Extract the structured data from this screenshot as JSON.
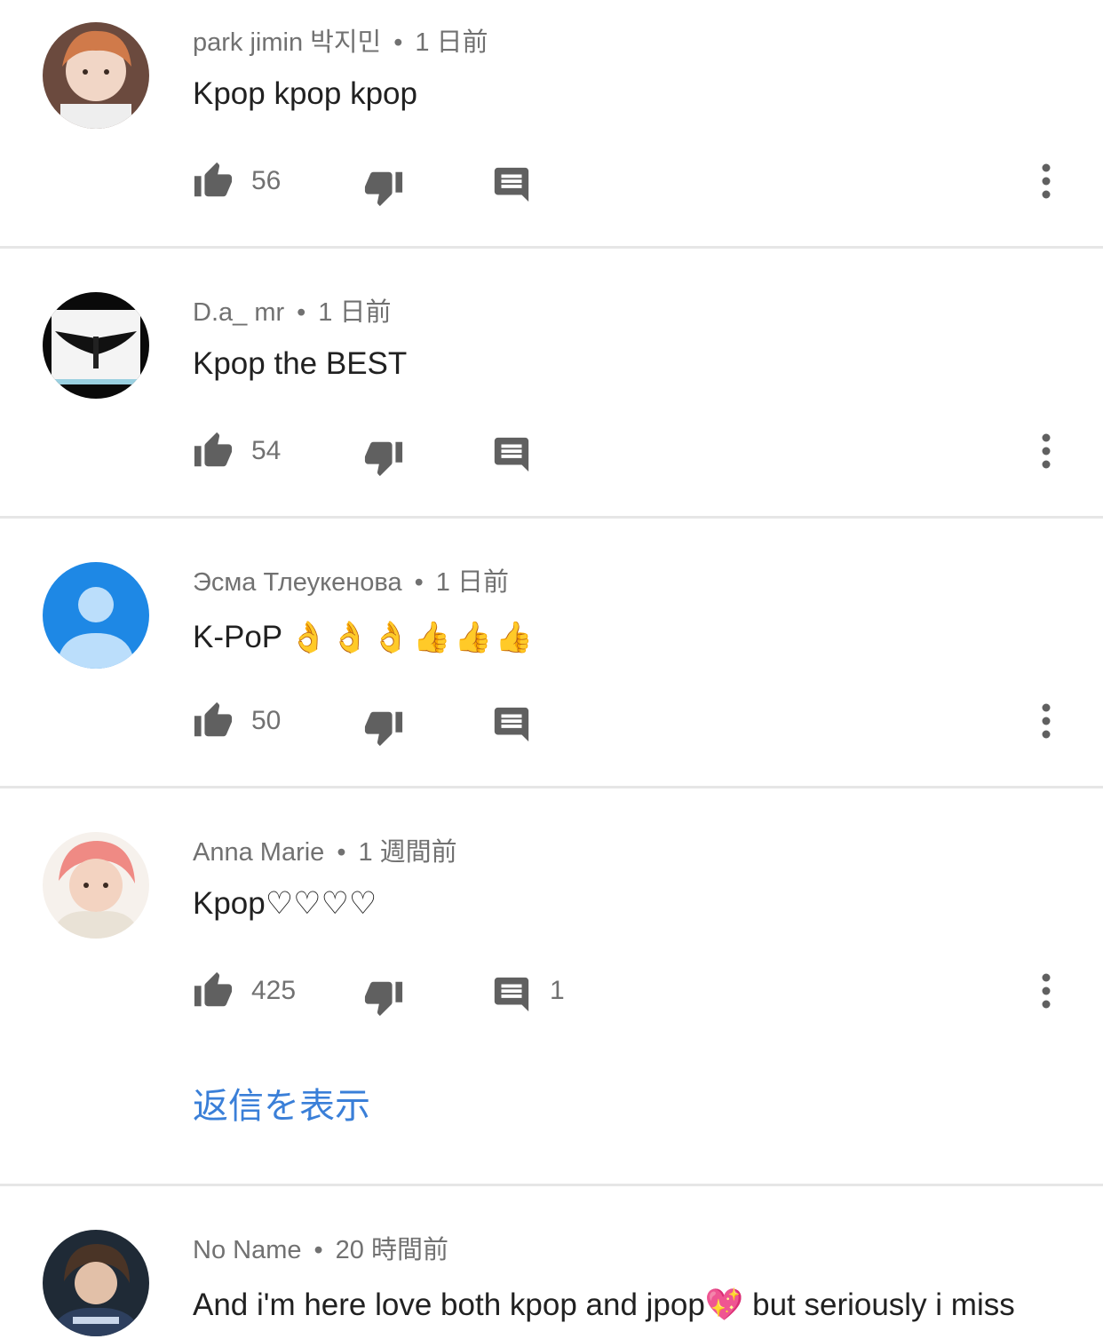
{
  "comments": [
    {
      "author": "park jimin 박지민",
      "time": "1 日前",
      "text": "Kpop kpop kpop",
      "emoji": "",
      "likes": "56",
      "replies": ""
    },
    {
      "author": "D.a_ mr",
      "time": "1 日前",
      "text": "Kpop the BEST",
      "emoji": "",
      "likes": "54",
      "replies": ""
    },
    {
      "author": "Эсма Тлеукенова",
      "time": "1 日前",
      "text": "K-PoP",
      "emoji": "👌👌👌👍👍👍",
      "likes": "50",
      "replies": ""
    },
    {
      "author": "Anna Marie",
      "time": "1 週間前",
      "text": "Kpop♡♡♡♡",
      "emoji": "",
      "likes": "425",
      "replies": "1",
      "view_replies_label": "返信を表示"
    },
    {
      "author": "No Name",
      "time": "20 時間前",
      "text": "And i'm here love both kpop and jpop💖 but seriously i miss",
      "emoji": ""
    }
  ],
  "separator": "•",
  "icons": {
    "like": "thumbs-up-icon",
    "dislike": "thumbs-down-icon",
    "reply": "reply-icon",
    "more": "more-vertical-icon"
  },
  "colors": {
    "icon": "#606060",
    "link": "#3a7fd8",
    "divider": "#e6e6e6"
  }
}
